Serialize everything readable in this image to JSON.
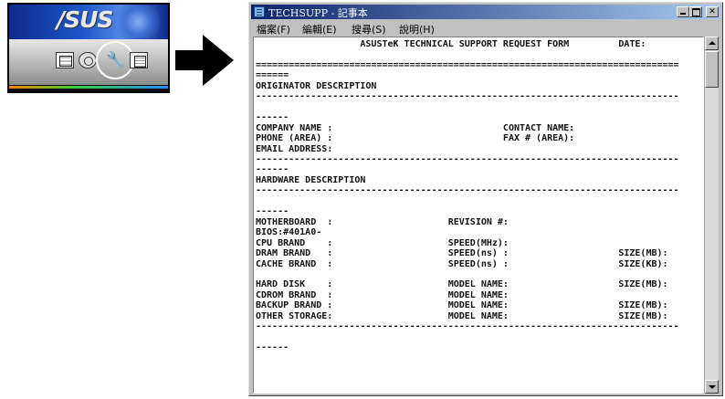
{
  "launcher": {
    "logo_text": "/SUS"
  },
  "window": {
    "title": "TECHSUPP - 記事本"
  },
  "menu": {
    "items": [
      "檔案(F)",
      "編輯(E)",
      "搜尋(S)",
      "說明(H)"
    ]
  },
  "document": {
    "lines": [
      "                   ASUSTeK TECHNICAL SUPPORT REQUEST FORM         DATE:",
      "",
      "=============================================================================",
      "======",
      "ORIGINATOR DESCRIPTION",
      "-----------------------------------------------------------------------------",
      "",
      "------",
      "COMPANY NAME :                               CONTACT NAME:",
      "PHONE (AREA) :                               FAX # (AREA):",
      "EMAIL ADDRESS:",
      "-----------------------------------------------------------------------------",
      "------",
      "HARDWARE DESCRIPTION",
      "-----------------------------------------------------------------------------",
      "",
      "------",
      "MOTHERBOARD  :                     REVISION #:",
      "BIOS:#401A0-",
      "CPU BRAND    :                     SPEED(MHz):",
      "DRAM BRAND   :                     SPEED(ns) :                    SIZE(MB):",
      "CACHE BRAND  :                     SPEED(ns) :                    SIZE(KB):",
      "",
      "HARD DISK    :                     MODEL NAME:                    SIZE(MB):",
      "CDROM BRAND  :                     MODEL NAME:",
      "BACKUP BRAND :                     MODEL NAME:                    SIZE(MB):",
      "OTHER STORAGE:                     MODEL NAME:                    SIZE(MB):",
      "-----------------------------------------------------------------------------",
      "",
      "------"
    ]
  }
}
